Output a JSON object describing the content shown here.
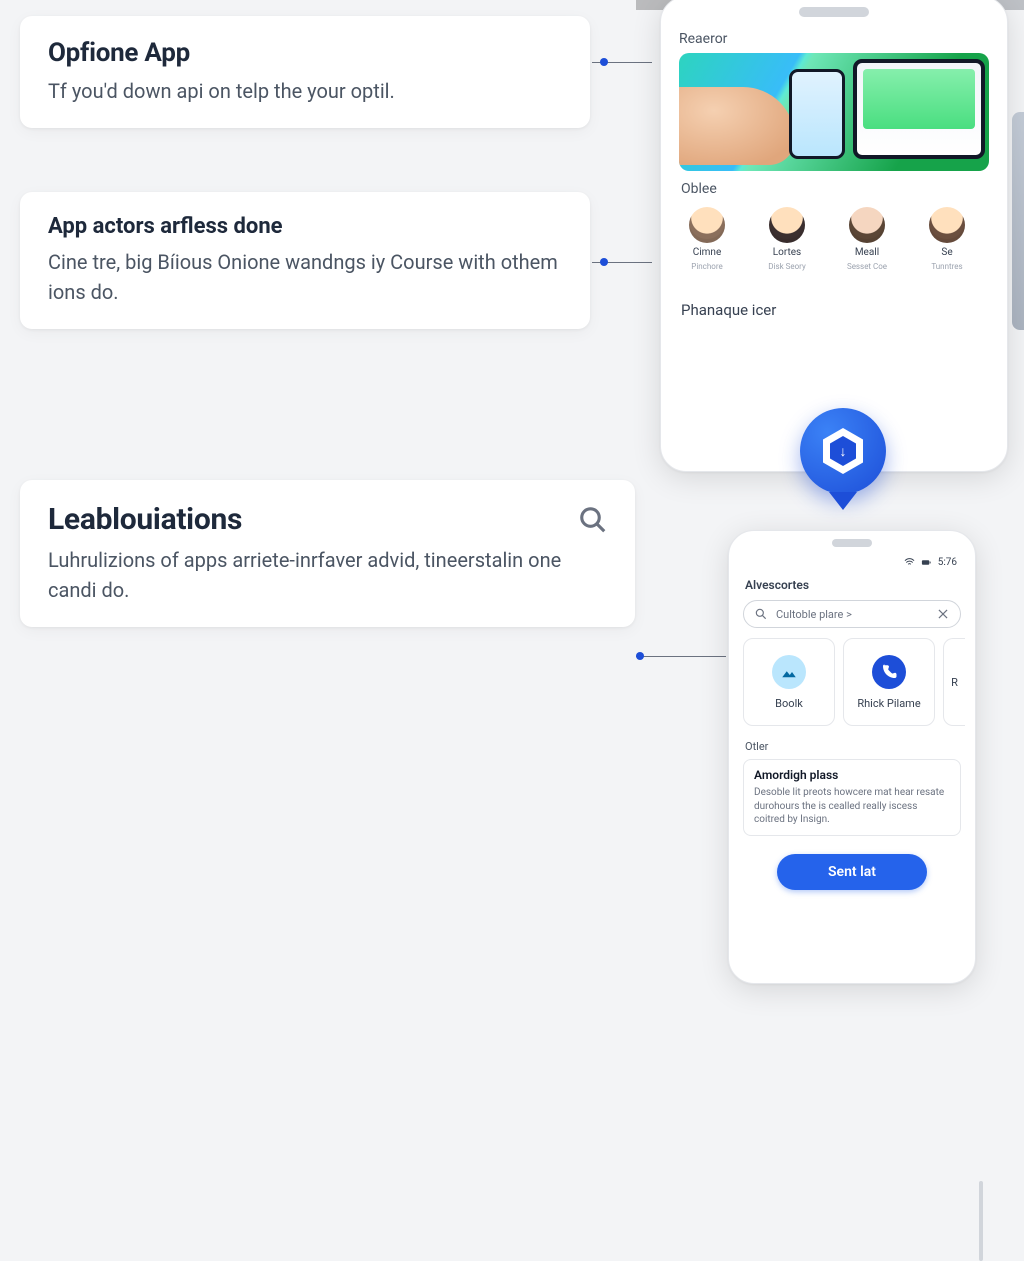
{
  "cards": {
    "c1": {
      "title": "Opfione App",
      "body": "Tf you'd down api on telp the your optil."
    },
    "c2": {
      "title": "App actors arfless done",
      "body": "Cine tre, big Bíious Onione wandngs iy Course with othem ions do."
    },
    "c3": {
      "title": "Leablouiations",
      "body": "Luhrulizions of apps arriete-inrfaver advid, tineerstalin one candi do."
    }
  },
  "device1": {
    "headerLabel": "Reaeror",
    "sectionLabel": "Oblee",
    "avatars": [
      {
        "name": "Cimne",
        "sub": "Pinchore"
      },
      {
        "name": "Lortes",
        "sub": "Disk Seory"
      },
      {
        "name": "Meall",
        "sub": "Sesset Coe"
      },
      {
        "name": "Se",
        "sub": "Tunntres"
      }
    ],
    "footerLabel": "Phanaque icer"
  },
  "pin": {
    "glyph": "↓"
  },
  "device2": {
    "status": {
      "time": "5:76"
    },
    "section": "Alvescortes",
    "search": {
      "placeholder": "Cultoble plare >"
    },
    "tiles": [
      {
        "id": "book",
        "label": "Boolk"
      },
      {
        "id": "phone",
        "label": "Rhick Pilame"
      },
      {
        "id": "edge",
        "label": "R"
      }
    ],
    "otherLabel": "Otler",
    "note": {
      "title": "Amordigh plass",
      "desc": "Desoble lit preots howcere mat hear resate durohours the is cealled really iscess coitred by Insign."
    },
    "primary": "Sent lat"
  }
}
